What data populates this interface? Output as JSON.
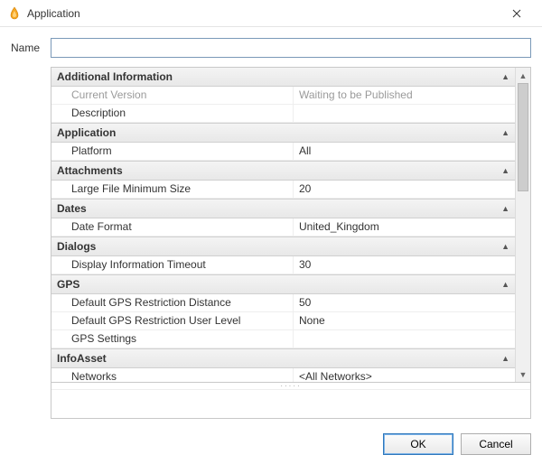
{
  "window": {
    "title": "Application"
  },
  "name": {
    "label": "Name",
    "value": ""
  },
  "groups": [
    {
      "title": "Additional Information",
      "rows": [
        {
          "key": "Current Version",
          "val": "Waiting to be Published",
          "disabled": true
        },
        {
          "key": "Description",
          "val": ""
        }
      ]
    },
    {
      "title": "Application",
      "rows": [
        {
          "key": "Platform",
          "val": "All"
        }
      ]
    },
    {
      "title": "Attachments",
      "rows": [
        {
          "key": "Large File Minimum Size",
          "val": "20"
        }
      ]
    },
    {
      "title": "Dates",
      "rows": [
        {
          "key": "Date Format",
          "val": "United_Kingdom"
        }
      ]
    },
    {
      "title": "Dialogs",
      "rows": [
        {
          "key": "Display Information Timeout",
          "val": "30"
        }
      ]
    },
    {
      "title": "GPS",
      "rows": [
        {
          "key": "Default GPS Restriction Distance",
          "val": "50"
        },
        {
          "key": "Default GPS Restriction User Level",
          "val": "None"
        },
        {
          "key": "GPS Settings",
          "val": ""
        }
      ]
    },
    {
      "title": "InfoAsset",
      "rows": [
        {
          "key": "Networks",
          "val": "<All Networks>"
        }
      ]
    }
  ],
  "buttons": {
    "ok": "OK",
    "cancel": "Cancel"
  },
  "handle": "·····"
}
